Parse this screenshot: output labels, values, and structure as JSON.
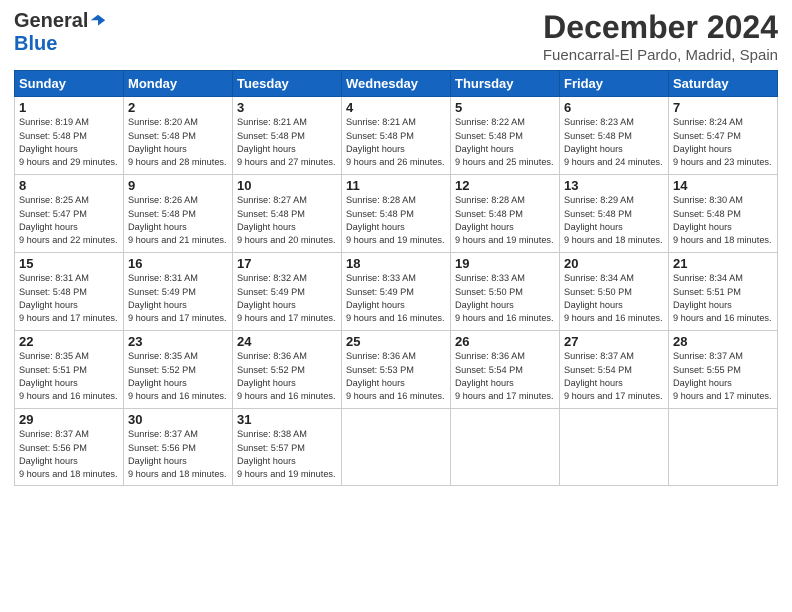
{
  "logo": {
    "general": "General",
    "blue": "Blue"
  },
  "title": "December 2024",
  "location": "Fuencarral-El Pardo, Madrid, Spain",
  "days_header": [
    "Sunday",
    "Monday",
    "Tuesday",
    "Wednesday",
    "Thursday",
    "Friday",
    "Saturday"
  ],
  "weeks": [
    [
      {
        "day": "1",
        "sunrise": "8:19 AM",
        "sunset": "5:48 PM",
        "daylight": "9 hours and 29 minutes."
      },
      {
        "day": "2",
        "sunrise": "8:20 AM",
        "sunset": "5:48 PM",
        "daylight": "9 hours and 28 minutes."
      },
      {
        "day": "3",
        "sunrise": "8:21 AM",
        "sunset": "5:48 PM",
        "daylight": "9 hours and 27 minutes."
      },
      {
        "day": "4",
        "sunrise": "8:21 AM",
        "sunset": "5:48 PM",
        "daylight": "9 hours and 26 minutes."
      },
      {
        "day": "5",
        "sunrise": "8:22 AM",
        "sunset": "5:48 PM",
        "daylight": "9 hours and 25 minutes."
      },
      {
        "day": "6",
        "sunrise": "8:23 AM",
        "sunset": "5:48 PM",
        "daylight": "9 hours and 24 minutes."
      },
      {
        "day": "7",
        "sunrise": "8:24 AM",
        "sunset": "5:47 PM",
        "daylight": "9 hours and 23 minutes."
      }
    ],
    [
      {
        "day": "8",
        "sunrise": "8:25 AM",
        "sunset": "5:47 PM",
        "daylight": "9 hours and 22 minutes."
      },
      {
        "day": "9",
        "sunrise": "8:26 AM",
        "sunset": "5:48 PM",
        "daylight": "9 hours and 21 minutes."
      },
      {
        "day": "10",
        "sunrise": "8:27 AM",
        "sunset": "5:48 PM",
        "daylight": "9 hours and 20 minutes."
      },
      {
        "day": "11",
        "sunrise": "8:28 AM",
        "sunset": "5:48 PM",
        "daylight": "9 hours and 19 minutes."
      },
      {
        "day": "12",
        "sunrise": "8:28 AM",
        "sunset": "5:48 PM",
        "daylight": "9 hours and 19 minutes."
      },
      {
        "day": "13",
        "sunrise": "8:29 AM",
        "sunset": "5:48 PM",
        "daylight": "9 hours and 18 minutes."
      },
      {
        "day": "14",
        "sunrise": "8:30 AM",
        "sunset": "5:48 PM",
        "daylight": "9 hours and 18 minutes."
      }
    ],
    [
      {
        "day": "15",
        "sunrise": "8:31 AM",
        "sunset": "5:48 PM",
        "daylight": "9 hours and 17 minutes."
      },
      {
        "day": "16",
        "sunrise": "8:31 AM",
        "sunset": "5:49 PM",
        "daylight": "9 hours and 17 minutes."
      },
      {
        "day": "17",
        "sunrise": "8:32 AM",
        "sunset": "5:49 PM",
        "daylight": "9 hours and 17 minutes."
      },
      {
        "day": "18",
        "sunrise": "8:33 AM",
        "sunset": "5:49 PM",
        "daylight": "9 hours and 16 minutes."
      },
      {
        "day": "19",
        "sunrise": "8:33 AM",
        "sunset": "5:50 PM",
        "daylight": "9 hours and 16 minutes."
      },
      {
        "day": "20",
        "sunrise": "8:34 AM",
        "sunset": "5:50 PM",
        "daylight": "9 hours and 16 minutes."
      },
      {
        "day": "21",
        "sunrise": "8:34 AM",
        "sunset": "5:51 PM",
        "daylight": "9 hours and 16 minutes."
      }
    ],
    [
      {
        "day": "22",
        "sunrise": "8:35 AM",
        "sunset": "5:51 PM",
        "daylight": "9 hours and 16 minutes."
      },
      {
        "day": "23",
        "sunrise": "8:35 AM",
        "sunset": "5:52 PM",
        "daylight": "9 hours and 16 minutes."
      },
      {
        "day": "24",
        "sunrise": "8:36 AM",
        "sunset": "5:52 PM",
        "daylight": "9 hours and 16 minutes."
      },
      {
        "day": "25",
        "sunrise": "8:36 AM",
        "sunset": "5:53 PM",
        "daylight": "9 hours and 16 minutes."
      },
      {
        "day": "26",
        "sunrise": "8:36 AM",
        "sunset": "5:54 PM",
        "daylight": "9 hours and 17 minutes."
      },
      {
        "day": "27",
        "sunrise": "8:37 AM",
        "sunset": "5:54 PM",
        "daylight": "9 hours and 17 minutes."
      },
      {
        "day": "28",
        "sunrise": "8:37 AM",
        "sunset": "5:55 PM",
        "daylight": "9 hours and 17 minutes."
      }
    ],
    [
      {
        "day": "29",
        "sunrise": "8:37 AM",
        "sunset": "5:56 PM",
        "daylight": "9 hours and 18 minutes."
      },
      {
        "day": "30",
        "sunrise": "8:37 AM",
        "sunset": "5:56 PM",
        "daylight": "9 hours and 18 minutes."
      },
      {
        "day": "31",
        "sunrise": "8:38 AM",
        "sunset": "5:57 PM",
        "daylight": "9 hours and 19 minutes."
      },
      null,
      null,
      null,
      null
    ]
  ]
}
